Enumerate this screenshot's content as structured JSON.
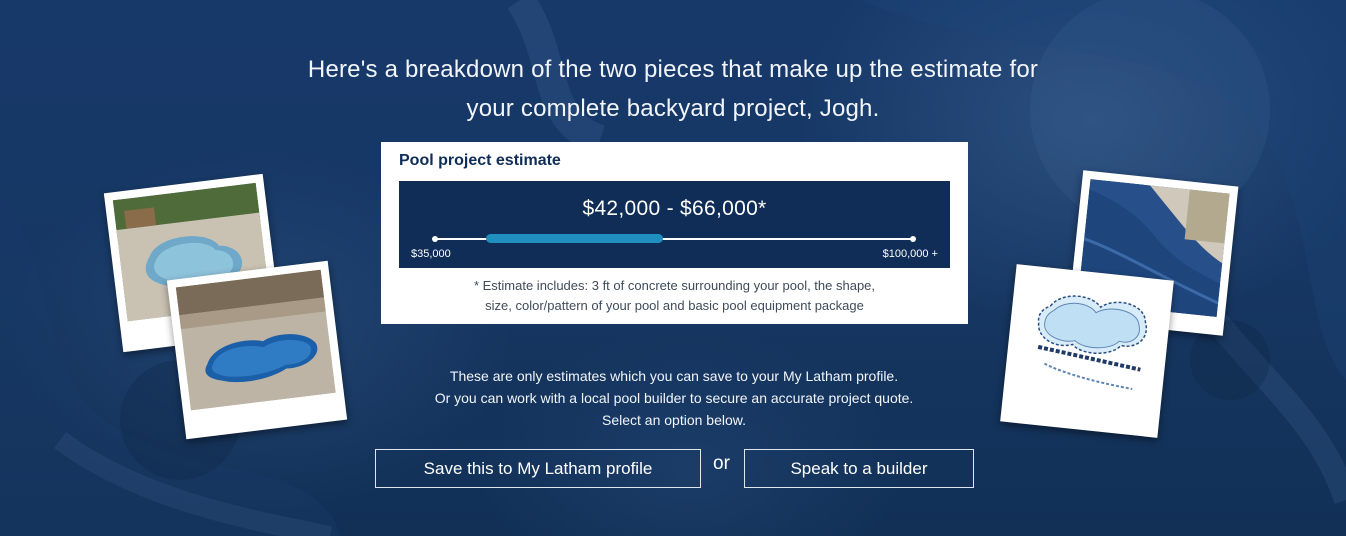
{
  "headline": {
    "line1": "Here's a breakdown of the two pieces that make up the estimate for",
    "line2": "your complete backyard project, Jogh."
  },
  "estimate_card": {
    "title": "Pool project estimate",
    "range_text": "$42,000 - $66,000*",
    "slider": {
      "min_label": "$35,000",
      "max_label": "$100,000 +",
      "min_value": 35000,
      "max_value": 100000,
      "low_value": 42000,
      "high_value": 66000
    },
    "disclaimer_line1": "* Estimate includes: 3 ft of concrete surrounding your pool, the shape,",
    "disclaimer_line2": "size, color/pattern of your pool and basic pool equipment package"
  },
  "info": {
    "line1": "These are only estimates which you can save to your My Latham profile.",
    "line2": "Or you can work with a local pool builder to secure an accurate project quote.",
    "line3": "Select an option below."
  },
  "actions": {
    "save_label": "Save this to My Latham profile",
    "or_label": "or",
    "builder_label": "Speak to a builder"
  },
  "colors": {
    "background": "#15365f",
    "card": "#ffffff",
    "range_box": "#0f2d56",
    "range_fill": "#1f8fc0",
    "text_light": "#f2f5fa"
  }
}
